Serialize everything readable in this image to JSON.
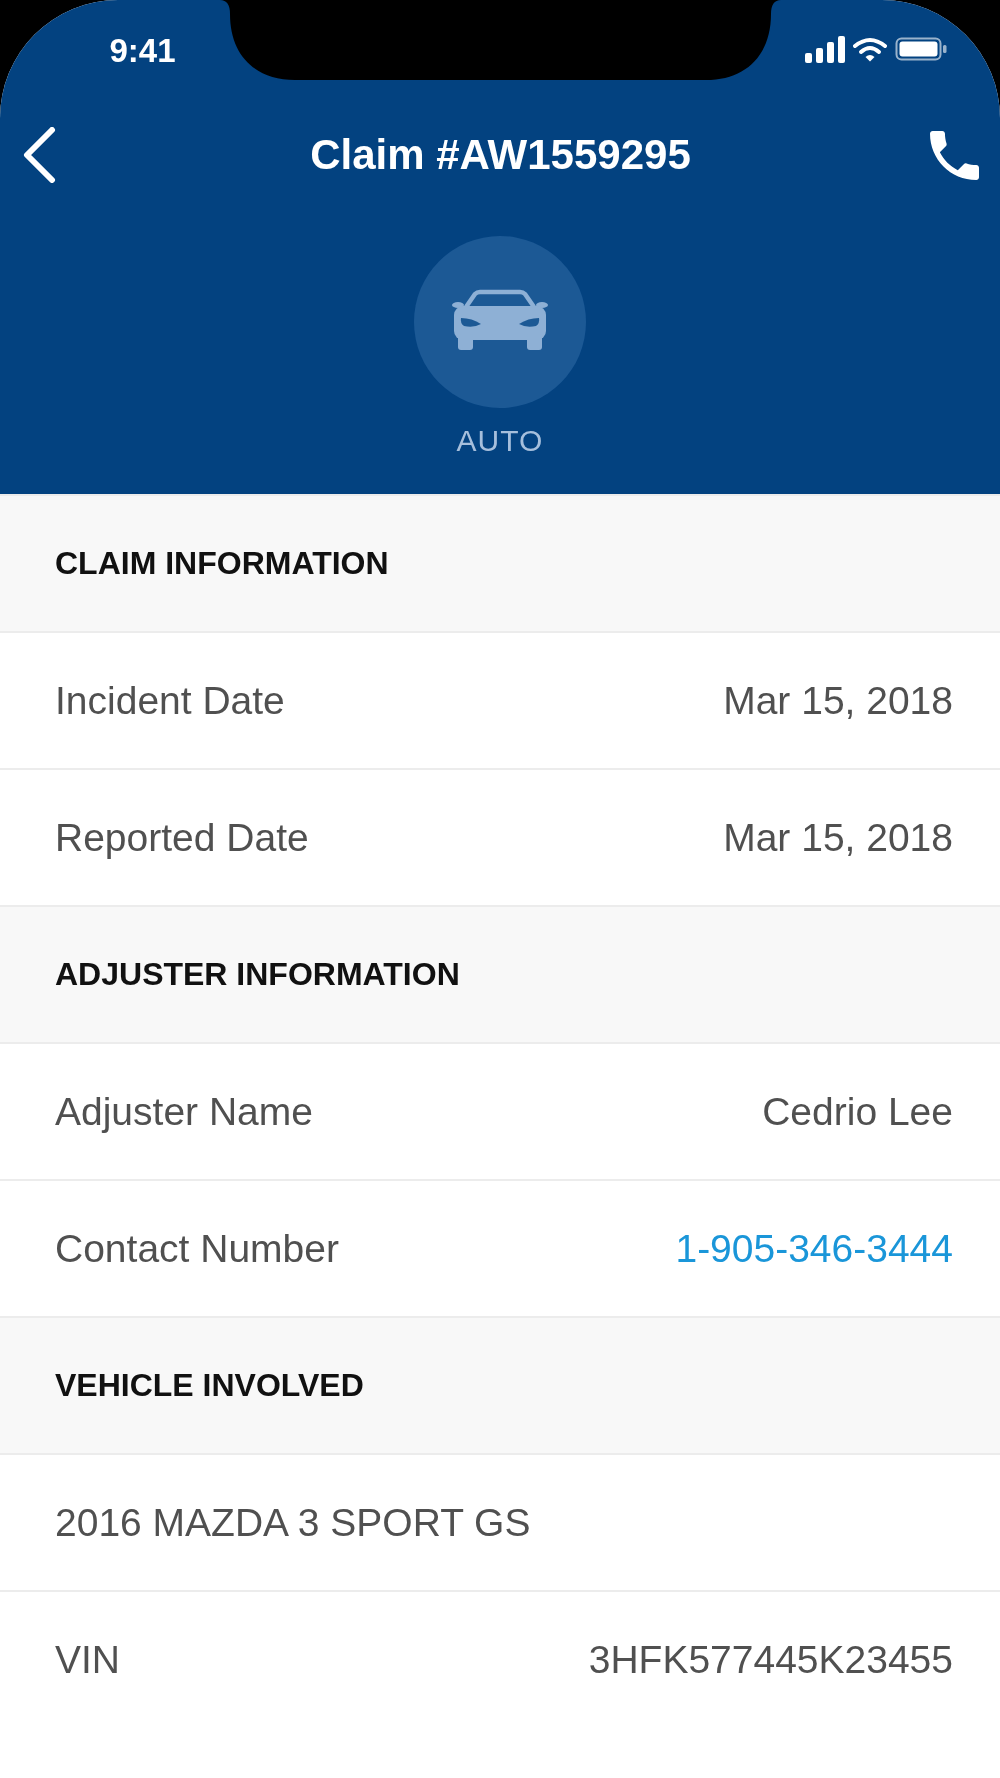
{
  "status_bar": {
    "time": "9:41"
  },
  "nav": {
    "title": "Claim #AW1559295"
  },
  "claim_type": {
    "label": "AUTO"
  },
  "sections": [
    {
      "title": "CLAIM INFORMATION",
      "rows": [
        {
          "kind": "text",
          "label": "Incident Date",
          "value": "Mar 15, 2018"
        },
        {
          "kind": "text",
          "label": "Reported Date",
          "value": "Mar 15, 2018"
        }
      ]
    },
    {
      "title": "ADJUSTER INFORMATION",
      "rows": [
        {
          "kind": "text",
          "label": "Adjuster Name",
          "value": "Cedrio Lee"
        },
        {
          "kind": "link",
          "label": "Contact Number",
          "value": "1-905-346-3444"
        }
      ]
    },
    {
      "title": "VEHICLE INVOLVED",
      "rows": [
        {
          "kind": "single",
          "value": "2016 MAZDA 3 SPORT GS"
        },
        {
          "kind": "text",
          "label": "VIN",
          "value": "3HFK577445K23455"
        }
      ]
    }
  ]
}
